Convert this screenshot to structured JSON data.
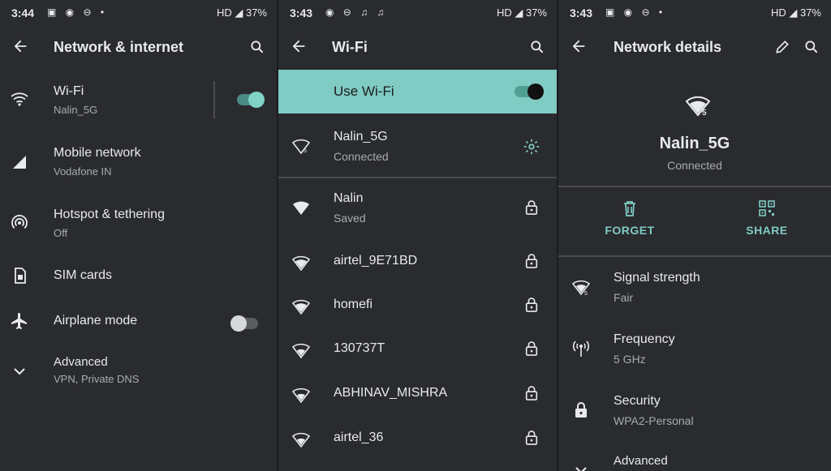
{
  "screen1": {
    "status": {
      "time": "3:44",
      "right": "HD ◢ 37%"
    },
    "title": "Network & internet",
    "items": [
      {
        "title": "Wi-Fi",
        "subtitle": "Nalin_5G"
      },
      {
        "title": "Mobile network",
        "subtitle": "Vodafone IN"
      },
      {
        "title": "Hotspot & tethering",
        "subtitle": "Off"
      },
      {
        "title": "SIM cards"
      },
      {
        "title": "Airplane mode"
      },
      {
        "title": "Advanced",
        "subtitle": "VPN, Private DNS"
      }
    ]
  },
  "screen2": {
    "status": {
      "time": "3:43",
      "right": "HD ◢ 37%"
    },
    "title": "Wi-Fi",
    "use_wifi_label": "Use Wi-Fi",
    "connected": {
      "name": "Nalin_5G",
      "status": "Connected"
    },
    "networks": [
      {
        "name": "Nalin",
        "status": "Saved"
      },
      {
        "name": "airtel_9E71BD"
      },
      {
        "name": "homefi"
      },
      {
        "name": "130737T"
      },
      {
        "name": "ABHINAV_MISHRA"
      },
      {
        "name": "airtel_36"
      }
    ]
  },
  "screen3": {
    "status": {
      "time": "3:43",
      "right": "HD ◢ 37%"
    },
    "title": "Network details",
    "network_name": "Nalin_5G",
    "network_status": "Connected",
    "forget_label": "FORGET",
    "share_label": "SHARE",
    "details": [
      {
        "title": "Signal strength",
        "value": "Fair"
      },
      {
        "title": "Frequency",
        "value": "5 GHz"
      },
      {
        "title": "Security",
        "value": "WPA2-Personal"
      },
      {
        "title": "Advanced"
      }
    ]
  },
  "colors": {
    "accent": "#80cbc4",
    "background": "#2a2b2e",
    "divider": "#4a4c50"
  }
}
